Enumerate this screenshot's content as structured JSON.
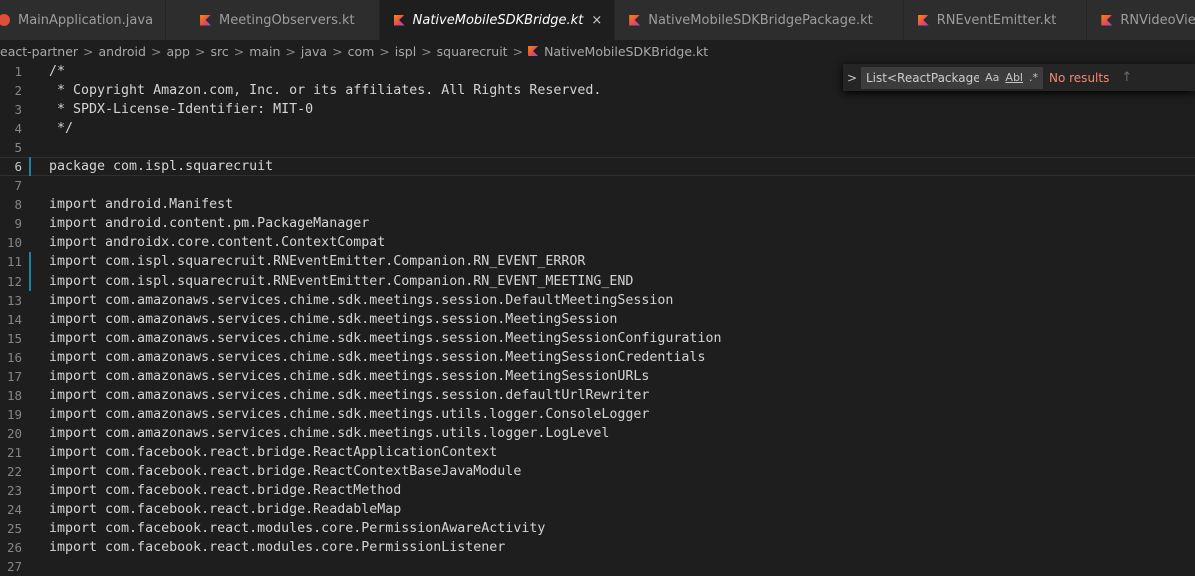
{
  "tabs": [
    {
      "label": "MainApplication.java",
      "icon": "react-icon",
      "active": false
    },
    {
      "label": "MeetingObservers.kt",
      "icon": "kotlin-icon",
      "active": false
    },
    {
      "label": "NativeMobileSDKBridge.kt",
      "icon": "kotlin-icon",
      "active": true,
      "close": "×"
    },
    {
      "label": "NativeMobileSDKBridgePackage.kt",
      "icon": "kotlin-icon",
      "active": false
    },
    {
      "label": "RNEventEmitter.kt",
      "icon": "kotlin-icon",
      "active": false
    },
    {
      "label": "RNVideoViewManager.kt",
      "icon": "kotlin-icon",
      "active": false
    }
  ],
  "breadcrumb": {
    "items": [
      "eact-partner",
      "android",
      "app",
      "src",
      "main",
      "java",
      "com",
      "ispl",
      "squarecruit"
    ],
    "separator": ">",
    "file": "NativeMobileSDKBridge.kt"
  },
  "find": {
    "toggle": ">",
    "query": "List<ReactPackage>",
    "match_case": "Aa",
    "whole_word": "Abl",
    "regex": ".*",
    "result": "No results",
    "prev": "↑"
  },
  "editor": {
    "current_line": 6,
    "modified_lines": [
      6,
      11,
      12
    ],
    "lines": [
      {
        "n": "1",
        "text": "/*"
      },
      {
        "n": "2",
        "text": " * Copyright Amazon.com, Inc. or its affiliates. All Rights Reserved."
      },
      {
        "n": "3",
        "text": " * SPDX-License-Identifier: MIT-0"
      },
      {
        "n": "4",
        "text": " */"
      },
      {
        "n": "5",
        "text": ""
      },
      {
        "n": "6",
        "text": "package com.ispl.squarecruit"
      },
      {
        "n": "7",
        "text": ""
      },
      {
        "n": "8",
        "text": "import android.Manifest"
      },
      {
        "n": "9",
        "text": "import android.content.pm.PackageManager"
      },
      {
        "n": "10",
        "text": "import androidx.core.content.ContextCompat"
      },
      {
        "n": "11",
        "text": "import com.ispl.squarecruit.RNEventEmitter.Companion.RN_EVENT_ERROR"
      },
      {
        "n": "12",
        "text": "import com.ispl.squarecruit.RNEventEmitter.Companion.RN_EVENT_MEETING_END"
      },
      {
        "n": "13",
        "text": "import com.amazonaws.services.chime.sdk.meetings.session.DefaultMeetingSession"
      },
      {
        "n": "14",
        "text": "import com.amazonaws.services.chime.sdk.meetings.session.MeetingSession"
      },
      {
        "n": "15",
        "text": "import com.amazonaws.services.chime.sdk.meetings.session.MeetingSessionConfiguration"
      },
      {
        "n": "16",
        "text": "import com.amazonaws.services.chime.sdk.meetings.session.MeetingSessionCredentials"
      },
      {
        "n": "17",
        "text": "import com.amazonaws.services.chime.sdk.meetings.session.MeetingSessionURLs"
      },
      {
        "n": "18",
        "text": "import com.amazonaws.services.chime.sdk.meetings.session.defaultUrlRewriter"
      },
      {
        "n": "19",
        "text": "import com.amazonaws.services.chime.sdk.meetings.utils.logger.ConsoleLogger"
      },
      {
        "n": "20",
        "text": "import com.amazonaws.services.chime.sdk.meetings.utils.logger.LogLevel"
      },
      {
        "n": "21",
        "text": "import com.facebook.react.bridge.ReactApplicationContext"
      },
      {
        "n": "22",
        "text": "import com.facebook.react.bridge.ReactContextBaseJavaModule"
      },
      {
        "n": "23",
        "text": "import com.facebook.react.bridge.ReactMethod"
      },
      {
        "n": "24",
        "text": "import com.facebook.react.bridge.ReadableMap"
      },
      {
        "n": "25",
        "text": "import com.facebook.react.modules.core.PermissionAwareActivity"
      },
      {
        "n": "26",
        "text": "import com.facebook.react.modules.core.PermissionListener"
      },
      {
        "n": "27",
        "text": ""
      }
    ]
  }
}
